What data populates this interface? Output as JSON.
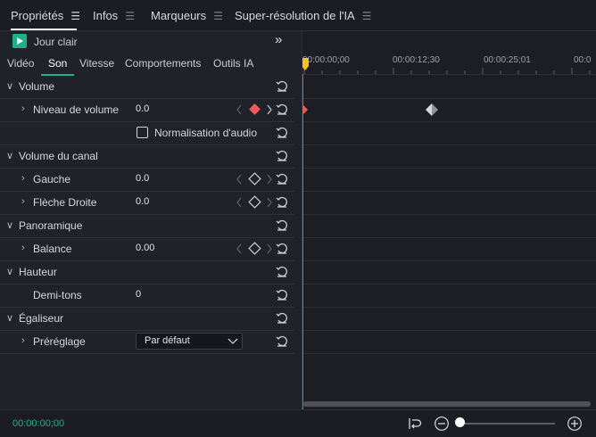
{
  "tabs": [
    {
      "label": "Propriétés",
      "active": true
    },
    {
      "label": "Infos",
      "active": false
    },
    {
      "label": "Marqueurs",
      "active": false
    },
    {
      "label": "Super-résolution de l'IA",
      "active": false
    }
  ],
  "play": {
    "label": "Jour clair",
    "expand_icon": "double-chevron-right-icon"
  },
  "subtabs": [
    {
      "label": "Vidéo",
      "active": false
    },
    {
      "label": "Son",
      "active": true
    },
    {
      "label": "Vitesse",
      "active": false
    },
    {
      "label": "Comportements",
      "active": false
    },
    {
      "label": "Outils IA",
      "active": false
    }
  ],
  "sections": {
    "volume": {
      "title": "Volume",
      "level_label": "Niveau de volume",
      "level_value": "0.0",
      "normalize_label": "Normalisation d'audio"
    },
    "channel": {
      "title": "Volume du canal",
      "left_label": "Gauche",
      "left_value": "0.0",
      "right_label": "Flèche Droite",
      "right_value": "0.0"
    },
    "pan": {
      "title": "Panoramique",
      "balance_label": "Balance",
      "balance_value": "0.00"
    },
    "pitch": {
      "title": "Hauteur",
      "semitones_label": "Demi-tons",
      "semitones_value": "0"
    },
    "eq": {
      "title": "Égaliseur",
      "preset_label": "Préréglage",
      "preset_value": "Par défaut"
    }
  },
  "timeline": {
    "ticks": [
      "00:00:00;00",
      "00:00:12;30",
      "00:00:25;01",
      "00:0"
    ]
  },
  "bottom": {
    "timecode": "00:00:00;00",
    "zoom_level": 0.0
  },
  "colors": {
    "accent": "#1fb08a",
    "keyframe_active": "#f25a5a",
    "playhead": "#f5c518"
  }
}
